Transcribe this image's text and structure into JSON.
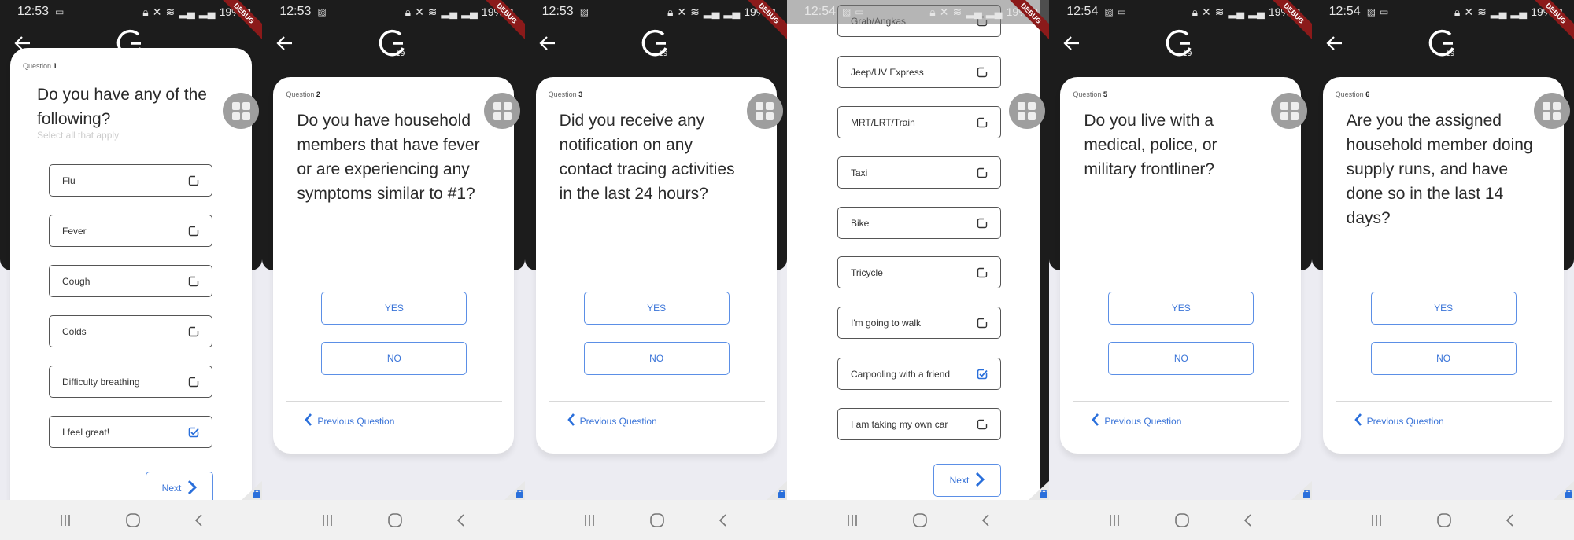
{
  "colors": {
    "accent": "#3a74d8",
    "header": "#1c1c1c",
    "background": "#ececf2",
    "debug": "#8b1a1a"
  },
  "status_common": {
    "battery": "19%",
    "debug_label": "DEBUG"
  },
  "labels": {
    "question": "Question",
    "next": "Next",
    "previous": "Previous Question",
    "yes": "YES",
    "no": "NO",
    "logo_text": "19"
  },
  "screens": [
    {
      "time": "12:53",
      "status_icons": [
        "laptop-icon"
      ],
      "type": "multi",
      "question_number": "1",
      "question": "Do you have any of the following?",
      "subtitle": "Select all that apply",
      "options": [
        {
          "label": "Flu",
          "checked": false
        },
        {
          "label": "Fever",
          "checked": false
        },
        {
          "label": "Cough",
          "checked": false
        },
        {
          "label": "Colds",
          "checked": false
        },
        {
          "label": "Difficulty breathing",
          "checked": false
        },
        {
          "label": "I feel great!",
          "checked": true
        }
      ]
    },
    {
      "time": "12:53",
      "status_icons": [
        "image-icon"
      ],
      "type": "yesno",
      "question_number": "2",
      "question": "Do you have household members that have fever or are experiencing any symptoms similar to #1?"
    },
    {
      "time": "12:53",
      "status_icons": [
        "image-icon"
      ],
      "type": "yesno",
      "question_number": "3",
      "question": "Did you receive any notification on any contact tracing activities in the last 24 hours?"
    },
    {
      "time": "12:54",
      "status_icons": [
        "image-icon",
        "laptop-icon"
      ],
      "type": "scrolled",
      "options": [
        {
          "label": "Grab/Angkas",
          "checked": false
        },
        {
          "label": "Jeep/UV Express",
          "checked": false
        },
        {
          "label": "MRT/LRT/Train",
          "checked": false
        },
        {
          "label": "Taxi",
          "checked": false
        },
        {
          "label": "Bike",
          "checked": false
        },
        {
          "label": "Tricycle",
          "checked": false
        },
        {
          "label": "I'm going to walk",
          "checked": false
        },
        {
          "label": "Carpooling with a friend",
          "checked": true
        },
        {
          "label": "I am taking my own car",
          "checked": false
        }
      ]
    },
    {
      "time": "12:54",
      "status_icons": [
        "image-icon",
        "laptop-icon"
      ],
      "type": "yesno",
      "question_number": "5",
      "question": "Do you live with a medical, police, or military frontliner?"
    },
    {
      "time": "12:54",
      "status_icons": [
        "image-icon",
        "laptop-icon"
      ],
      "type": "yesno",
      "question_number": "6",
      "question": "Are you the assigned household member doing supply runs, and have done so in the last 14 days?"
    }
  ]
}
